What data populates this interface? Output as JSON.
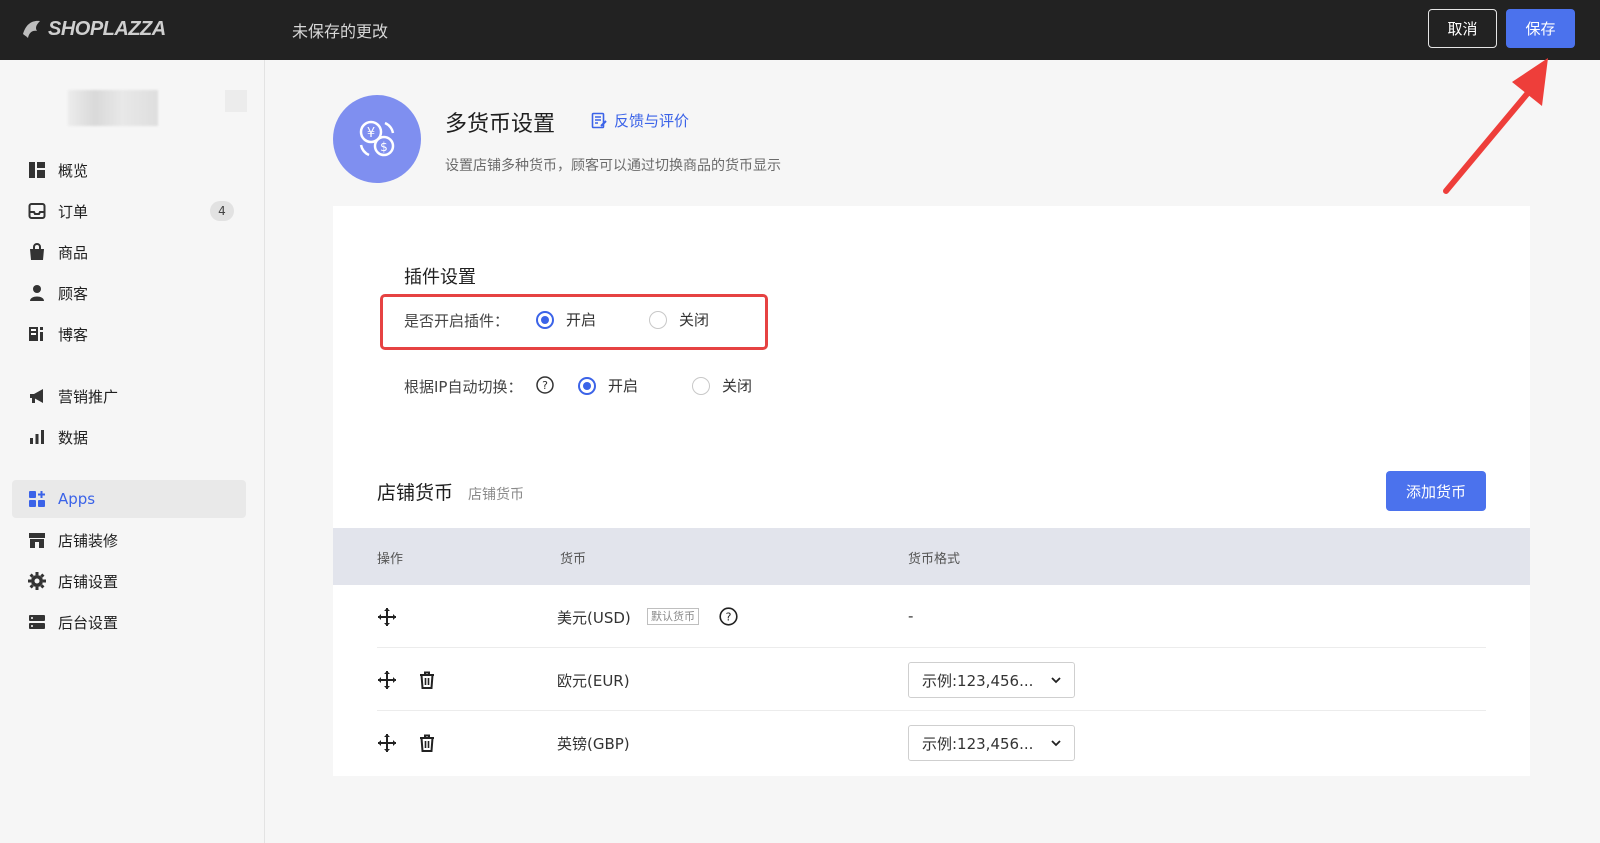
{
  "topbar": {
    "logo_text": "SHOPLAZZA",
    "status": "未保存的更改",
    "cancel_label": "取消",
    "save_label": "保存"
  },
  "sidebar": {
    "items": [
      {
        "label": "概览",
        "icon": "dashboard-icon"
      },
      {
        "label": "订单",
        "icon": "inbox-icon",
        "badge": "4"
      },
      {
        "label": "商品",
        "icon": "bag-icon"
      },
      {
        "label": "顾客",
        "icon": "person-icon"
      },
      {
        "label": "博客",
        "icon": "blog-icon"
      },
      {
        "label": "营销推广",
        "icon": "megaphone-icon"
      },
      {
        "label": "数据",
        "icon": "bar-chart-icon"
      },
      {
        "label": "Apps",
        "icon": "apps-icon",
        "active": true
      },
      {
        "label": "店铺装修",
        "icon": "storefront-icon"
      },
      {
        "label": "店铺设置",
        "icon": "gear-icon"
      },
      {
        "label": "后台设置",
        "icon": "server-icon"
      }
    ]
  },
  "header": {
    "title": "多货币设置",
    "feedback_label": "反馈与评价",
    "description": "设置店铺多种货币，顾客可以通过切换商品的货币显示"
  },
  "plugin": {
    "section_title": "插件设置",
    "enable_label": "是否开启插件：",
    "enable_on": "开启",
    "enable_off": "关闭",
    "enable_value": "开启",
    "ip_label": "根据IP自动切换：",
    "ip_on": "开启",
    "ip_off": "关闭",
    "ip_value": "开启"
  },
  "currencies": {
    "title": "店铺货币",
    "subtitle": "店铺货币",
    "add_label": "添加货币",
    "columns": [
      "操作",
      "货币",
      "货币格式"
    ],
    "rows": [
      {
        "name": "美元(USD)",
        "default_tag": "默认货币",
        "format": "-",
        "deletable": false
      },
      {
        "name": "欧元(EUR)",
        "format": "示例:123,456...",
        "deletable": true
      },
      {
        "name": "英镑(GBP)",
        "format": "示例:123,456...",
        "deletable": true
      }
    ]
  },
  "colors": {
    "primary": "#4b72ed",
    "topbar": "#222222",
    "highlight": "#e64242",
    "app_icon": "#7f8ff0"
  }
}
